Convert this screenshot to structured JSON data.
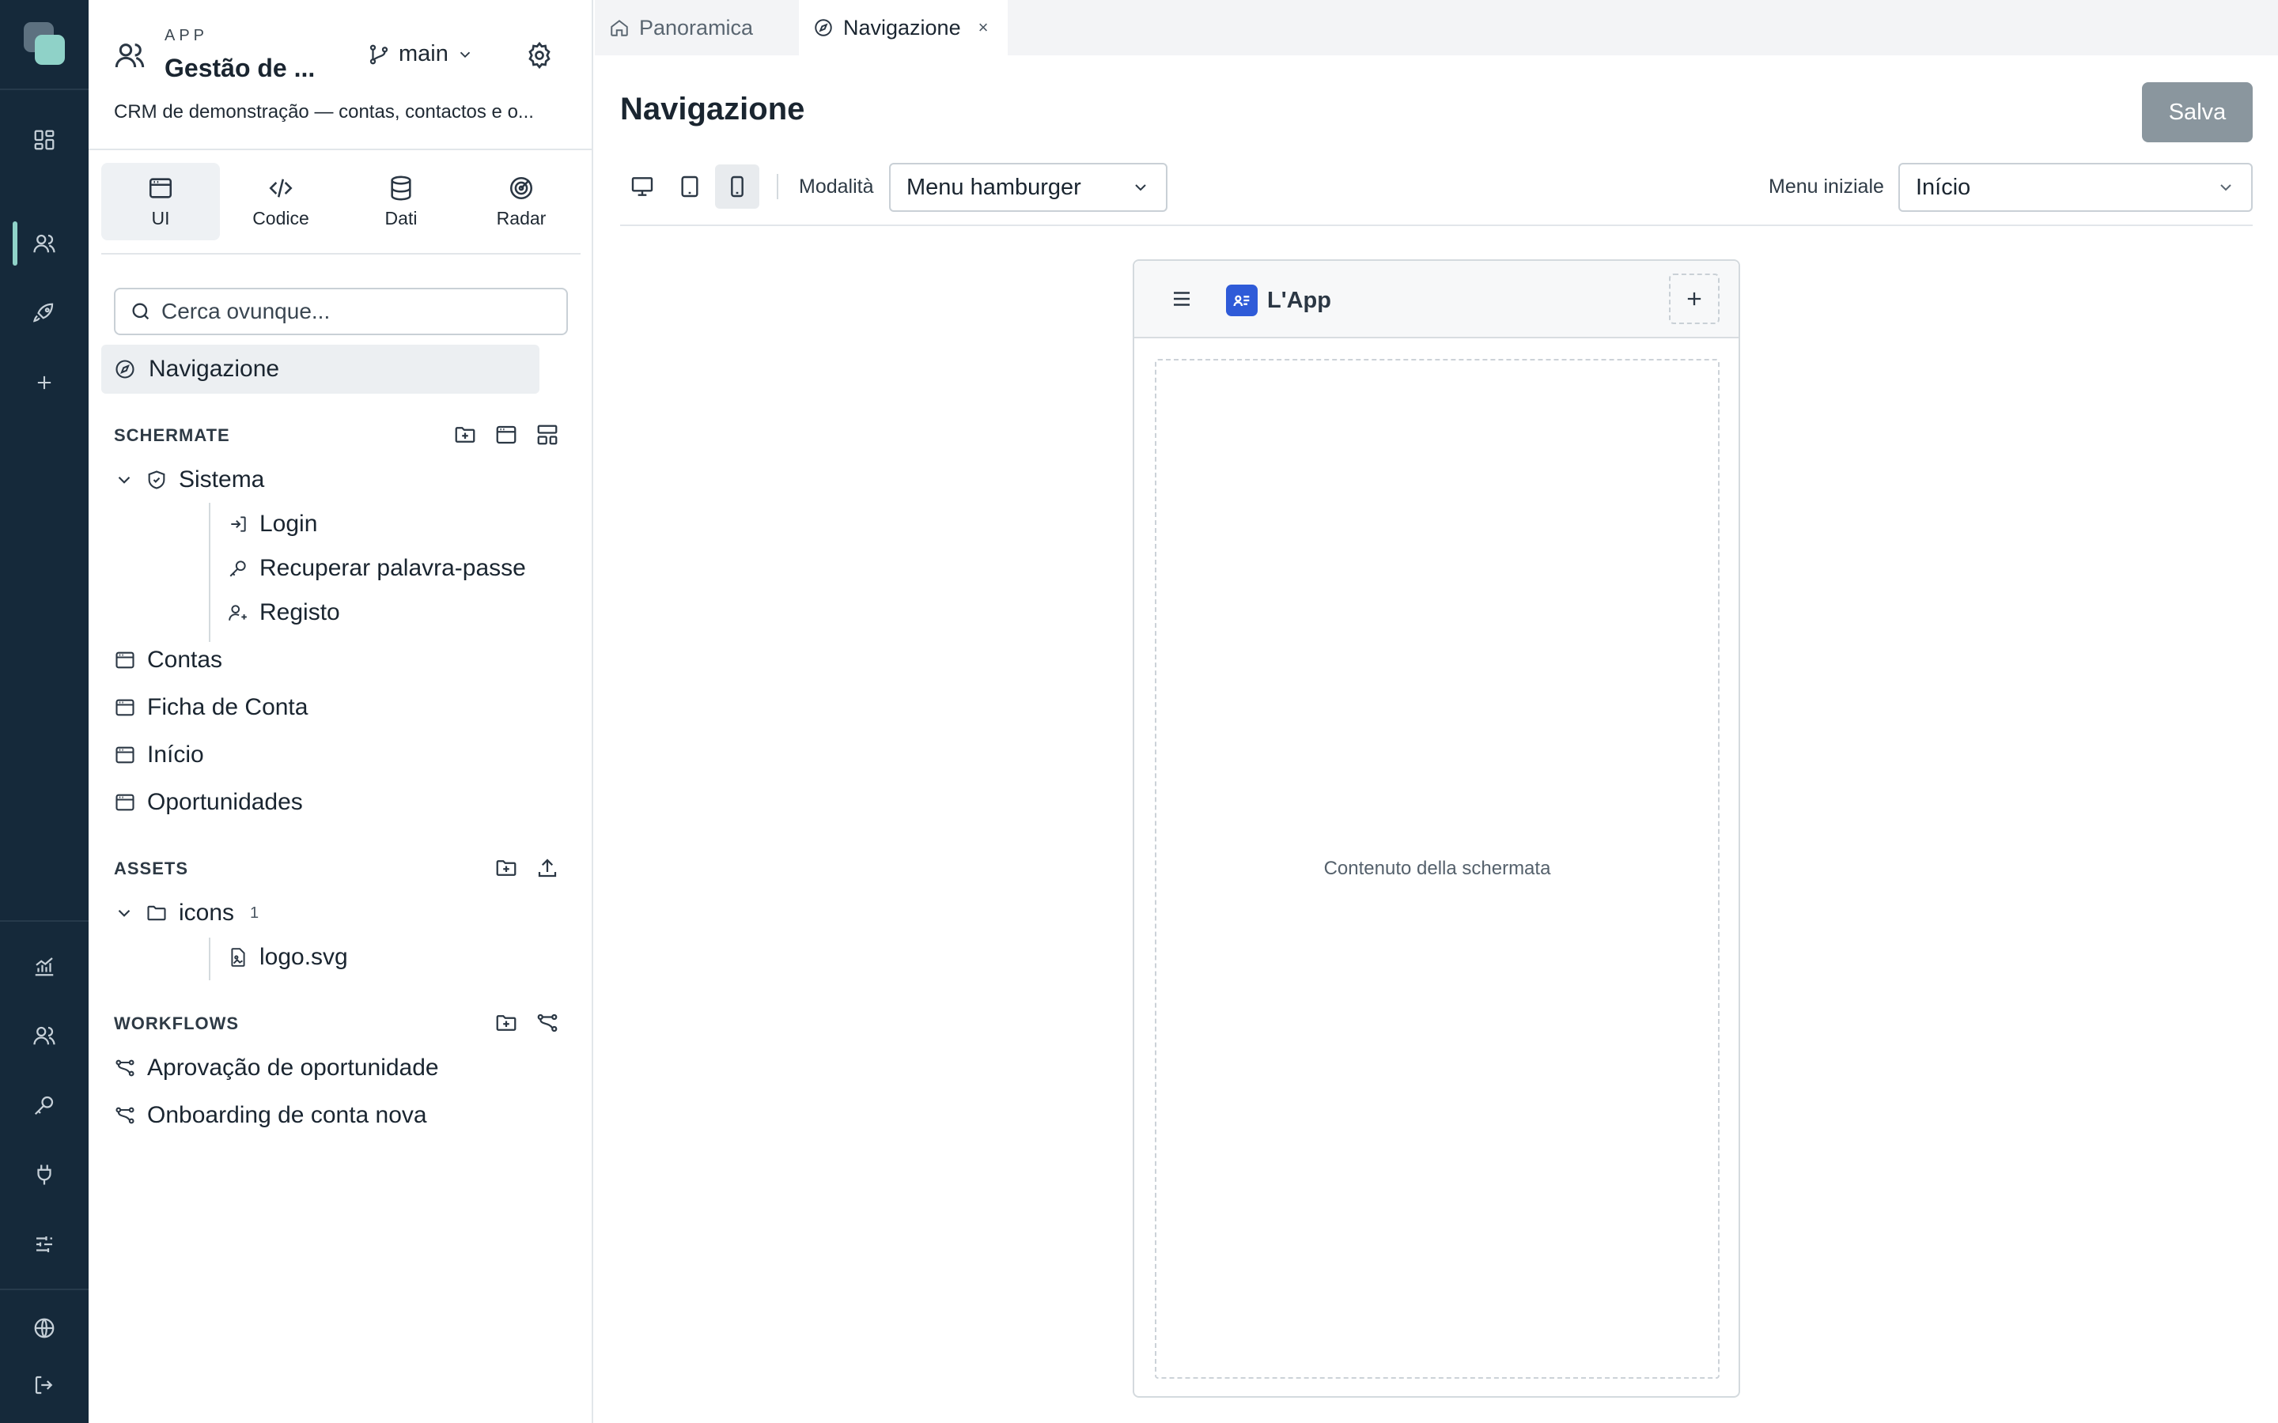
{
  "rail": {
    "icons": [
      "dashboard-icon",
      "users-icon",
      "rocket-icon",
      "plus-icon",
      "analytics-icon",
      "team-icon",
      "key-icon",
      "plug-icon",
      "sliders-icon",
      "globe-icon",
      "logout-icon"
    ]
  },
  "app": {
    "kicker": "APP",
    "name": "Gestão de ...",
    "branch": "main",
    "description": "CRM de demonstração — contas, contactos e o..."
  },
  "modes": [
    {
      "label": "UI",
      "icon": "window-icon",
      "active": true
    },
    {
      "label": "Codice",
      "icon": "code-icon",
      "active": false
    },
    {
      "label": "Dati",
      "icon": "database-icon",
      "active": false
    },
    {
      "label": "Radar",
      "icon": "radar-icon",
      "active": false
    }
  ],
  "search": {
    "placeholder": "Cerca ovunque..."
  },
  "navigation_item": "Navigazione",
  "sections": {
    "screens": {
      "title": "SCHERMATE",
      "folder": "Sistema",
      "folder_children": [
        "Login",
        "Recuperar palavra-passe",
        "Registo"
      ],
      "items": [
        "Contas",
        "Ficha de Conta",
        "Início",
        "Oportunidades"
      ]
    },
    "assets": {
      "title": "ASSETS",
      "folder": "icons",
      "folder_count": "1",
      "files": [
        "logo.svg"
      ]
    },
    "workflows": {
      "title": "WORKFLOWS",
      "items": [
        "Aprovação de oportunidade",
        "Onboarding de conta nova"
      ]
    }
  },
  "tabs": [
    {
      "label": "Panoramica",
      "icon": "home-icon",
      "active": false
    },
    {
      "label": "Navigazione",
      "icon": "compass-icon",
      "active": true,
      "close": "×"
    }
  ],
  "page": {
    "title": "Navigazione",
    "save_label": "Salva"
  },
  "toolbar": {
    "devices": [
      "desktop",
      "tablet",
      "mobile"
    ],
    "selected_device": "mobile",
    "mode_label": "Modalità",
    "mode_value": "Menu hamburger",
    "initial_menu_label": "Menu iniziale",
    "initial_menu_value": "Início"
  },
  "preview": {
    "app_title": "L'App",
    "content_placeholder": "Contenuto della schermata"
  },
  "colors": {
    "rail_bg": "#15293a",
    "accent": "#8fd2c8",
    "save_button": "#8a969e",
    "app_logo": "#2f5bd8"
  }
}
